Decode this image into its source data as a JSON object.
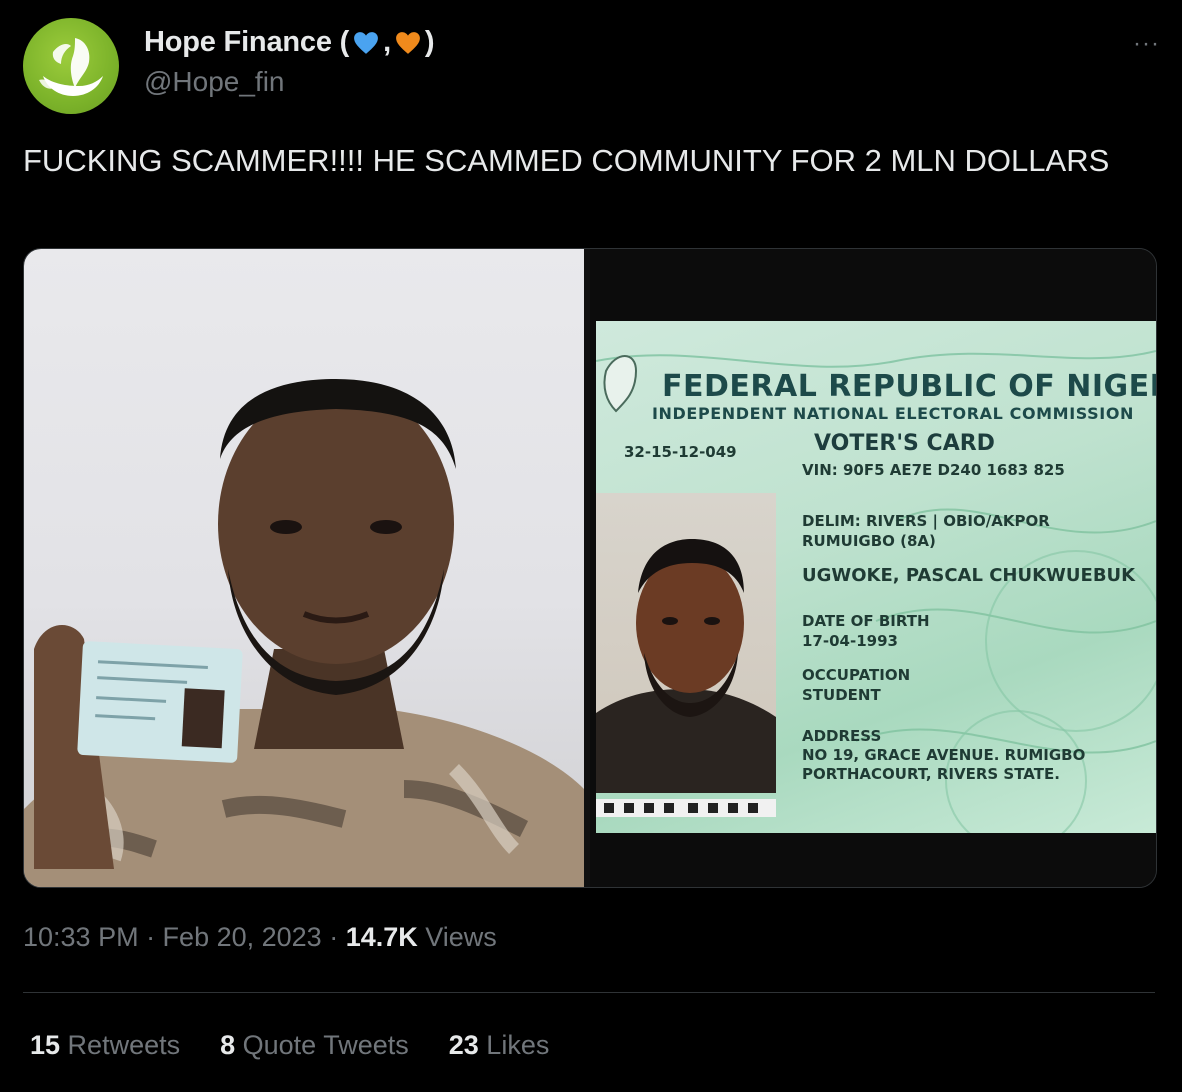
{
  "tweet": {
    "author": {
      "display_name": "Hope Finance (",
      "name_sep": ",",
      "name_end": ")",
      "handle": "@Hope_fin",
      "emoji_1_color": "#4aa3f0",
      "emoji_2_color": "#f08a1c"
    },
    "more_label": "···",
    "text": "FUCKING SCAMMER!!!! HE SCAMMED COMMUNITY FOR 2 MLN DOLLARS",
    "media": {
      "card": {
        "title": "FEDERAL REPUBLIC OF NIGERIA",
        "subtitle": "INDEPENDENT NATIONAL ELECTORAL COMMISSION",
        "card_type": "VOTER'S CARD",
        "code": "32-15-12-049",
        "vin": "VIN: 90F5  AE7E  D240  1683  825",
        "delim_line1": "DELIM: RIVERS  |  OBIO/AKPOR",
        "delim_line2": "RUMUIGBO (8A)",
        "holder_name": "UGWOKE, PASCAL CHUKWUEBUK",
        "dob_label": "DATE OF BIRTH",
        "dob_value": "17-04-1993",
        "occupation_label": "OCCUPATION",
        "occupation_value": "STUDENT",
        "address_label": "ADDRESS",
        "address_line1": "NO 19, GRACE AVENUE. RUMIGBO",
        "address_line2": "PORTHACOURT, RIVERS STATE."
      }
    },
    "timestamp": "10:33 PM · Feb 20, 2023 · ",
    "views_count": "14.7K",
    "views_label": " Views",
    "stats": {
      "retweets_count": "15",
      "retweets_label": " Retweets",
      "quotes_count": "8",
      "quotes_label": " Quote Tweets",
      "likes_count": "23",
      "likes_label": " Likes"
    }
  }
}
